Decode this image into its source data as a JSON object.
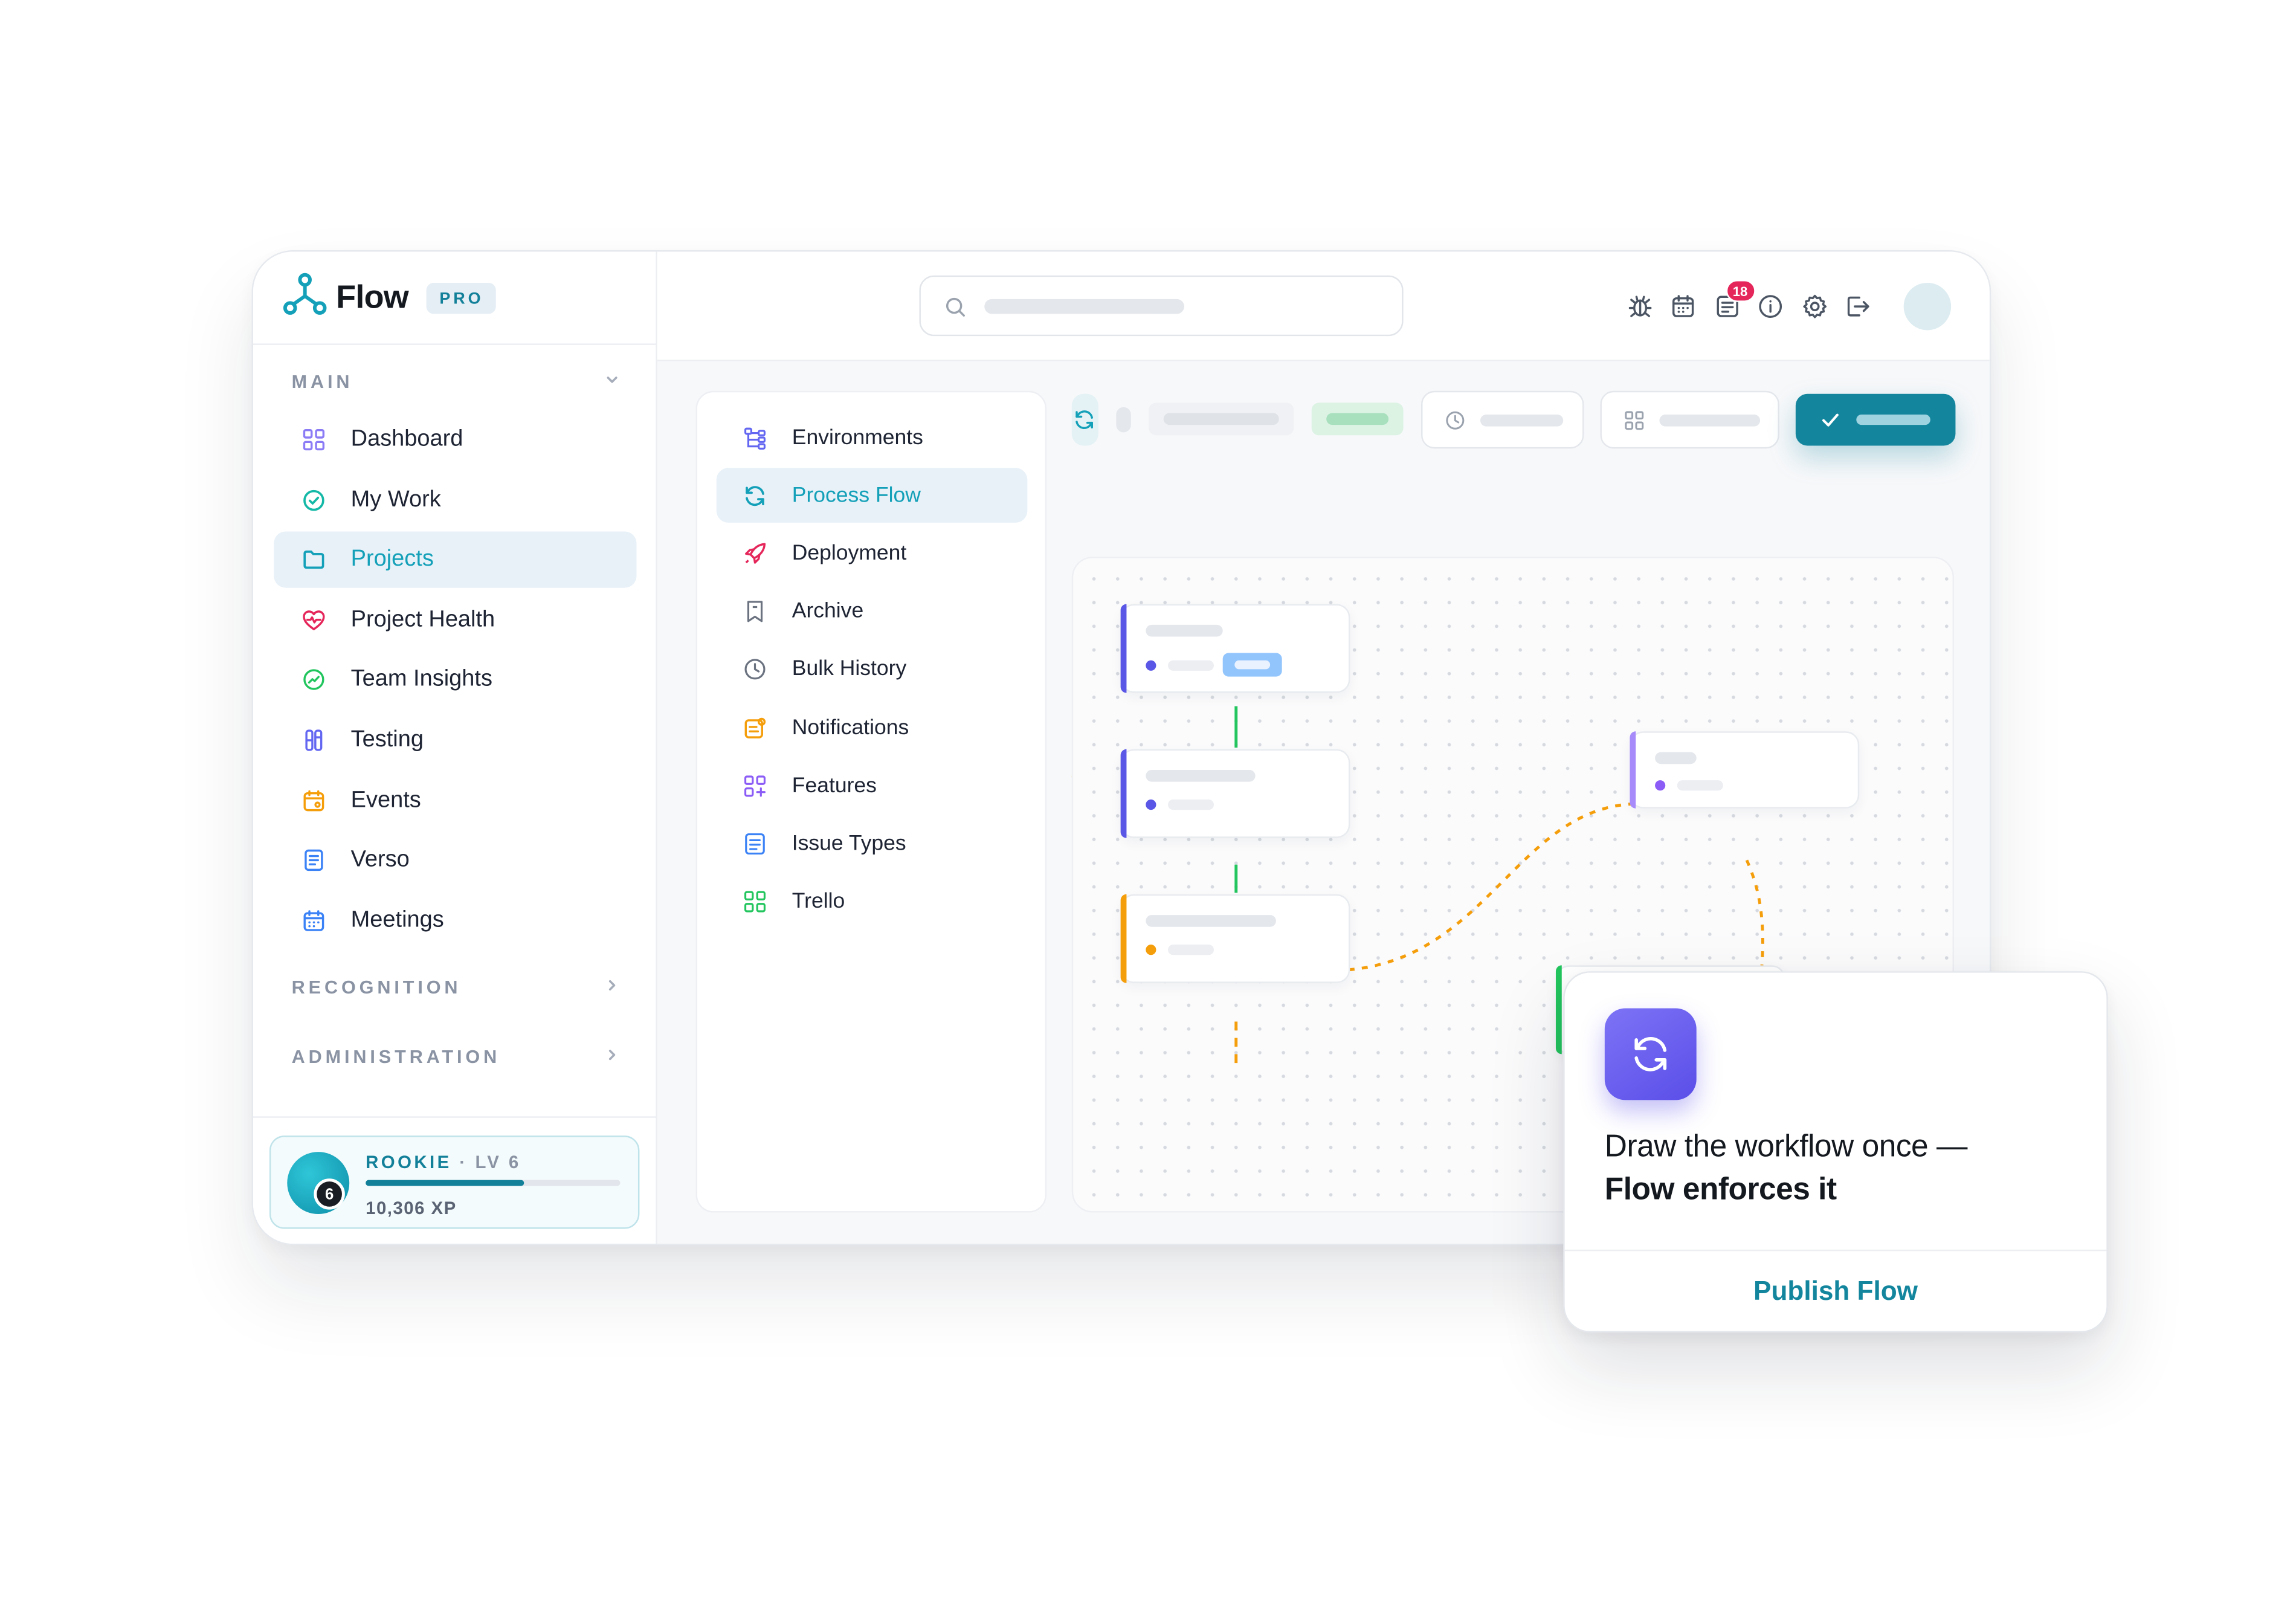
{
  "brand": {
    "name": "Flow",
    "badge": "PRO"
  },
  "sidebar": {
    "sections": {
      "main": "MAIN",
      "recognition": "RECOGNITION",
      "administration": "ADMINISTRATION"
    },
    "items": [
      {
        "label": "Dashboard",
        "icon": "grid-icon"
      },
      {
        "label": "My Work",
        "icon": "check-circle-icon"
      },
      {
        "label": "Projects",
        "icon": "folder-icon",
        "active": true
      },
      {
        "label": "Project Health",
        "icon": "heart-pulse-icon"
      },
      {
        "label": "Team Insights",
        "icon": "trend-icon"
      },
      {
        "label": "Testing",
        "icon": "test-tubes-icon"
      },
      {
        "label": "Events",
        "icon": "calendar-star-icon"
      },
      {
        "label": "Verso",
        "icon": "document-icon"
      },
      {
        "label": "Meetings",
        "icon": "calendar-icon"
      }
    ],
    "profile": {
      "rank": "ROOKIE",
      "separator": "·",
      "level_label": "LV 6",
      "level": "6",
      "xp": "10,306 XP",
      "progress": 0.62
    }
  },
  "header": {
    "icons": [
      "bug-icon",
      "calendar-icon",
      "inbox-icon",
      "info-icon",
      "settings-icon",
      "logout-icon"
    ],
    "notifications_count": "18"
  },
  "subnav": {
    "items": [
      {
        "label": "Environments",
        "icon": "hierarchy-icon"
      },
      {
        "label": "Process Flow",
        "icon": "refresh-icon",
        "active": true
      },
      {
        "label": "Deployment",
        "icon": "rocket-icon"
      },
      {
        "label": "Archive",
        "icon": "archive-icon"
      },
      {
        "label": "Bulk History",
        "icon": "clock-icon"
      },
      {
        "label": "Notifications",
        "icon": "notification-icon"
      },
      {
        "label": "Features",
        "icon": "features-icon"
      },
      {
        "label": "Issue Types",
        "icon": "list-icon"
      },
      {
        "label": "Trello",
        "icon": "board-icon"
      }
    ]
  },
  "colors": {
    "accent": "#13869e",
    "active_text": "#13a0b8",
    "active_bg": "#e8f1f8",
    "purple": "#5b57e6",
    "orange": "#f59e0b",
    "green": "#22c55e",
    "badge": "#e5265b"
  },
  "popover": {
    "line1": "Draw the workflow once —",
    "line2": "Flow enforces it",
    "button": "Publish Flow",
    "icon": "refresh-icon"
  }
}
